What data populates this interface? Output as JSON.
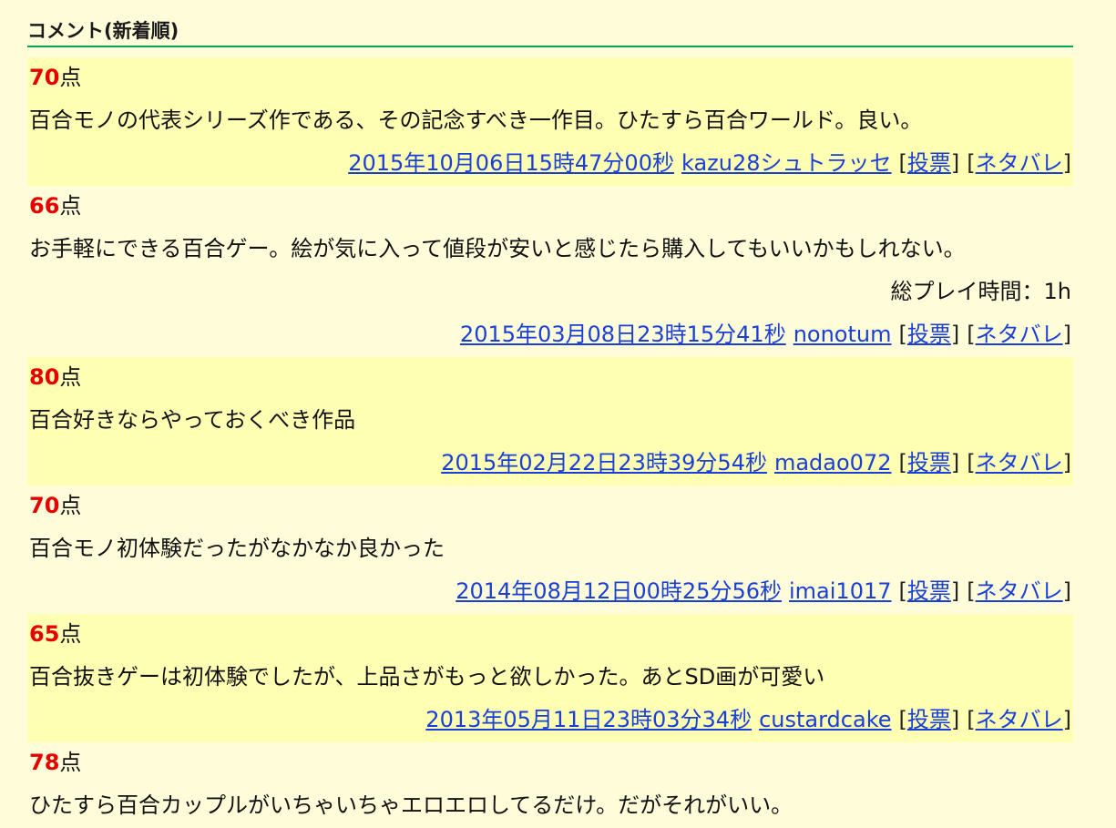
{
  "section": {
    "title": "コメント(新着順)"
  },
  "score_unit": "点",
  "vote_label": "投票",
  "spoiler_label": "ネタバレ",
  "comments": [
    {
      "score": "70",
      "text": "百合モノの代表シリーズ作である、その記念すべき一作目。ひたすら百合ワールド。良い。",
      "playtime": "",
      "date": "2015年10月06日15時47分00秒",
      "user": "kazu28シュトラッセ"
    },
    {
      "score": "66",
      "text": "お手軽にできる百合ゲー。絵が気に入って値段が安いと感じたら購入してもいいかもしれない。",
      "playtime": "総プレイ時間：1h",
      "date": "2015年03月08日23時15分41秒",
      "user": "nonotum"
    },
    {
      "score": "80",
      "text": "百合好きならやっておくべき作品",
      "playtime": "",
      "date": "2015年02月22日23時39分54秒",
      "user": "madao072"
    },
    {
      "score": "70",
      "text": "百合モノ初体験だったがなかなか良かった",
      "playtime": "",
      "date": "2014年08月12日00時25分56秒",
      "user": "imai1017"
    },
    {
      "score": "65",
      "text": "百合抜きゲーは初体験でしたが、上品さがもっと欲しかった。あとSD画が可愛い",
      "playtime": "",
      "date": "2013年05月11日23時03分34秒",
      "user": "custardcake"
    },
    {
      "score": "78",
      "text": "ひたすら百合カップルがいちゃいちゃエロエロしてるだけ。だがそれがいい。",
      "playtime": "",
      "date": "",
      "user": ""
    }
  ]
}
